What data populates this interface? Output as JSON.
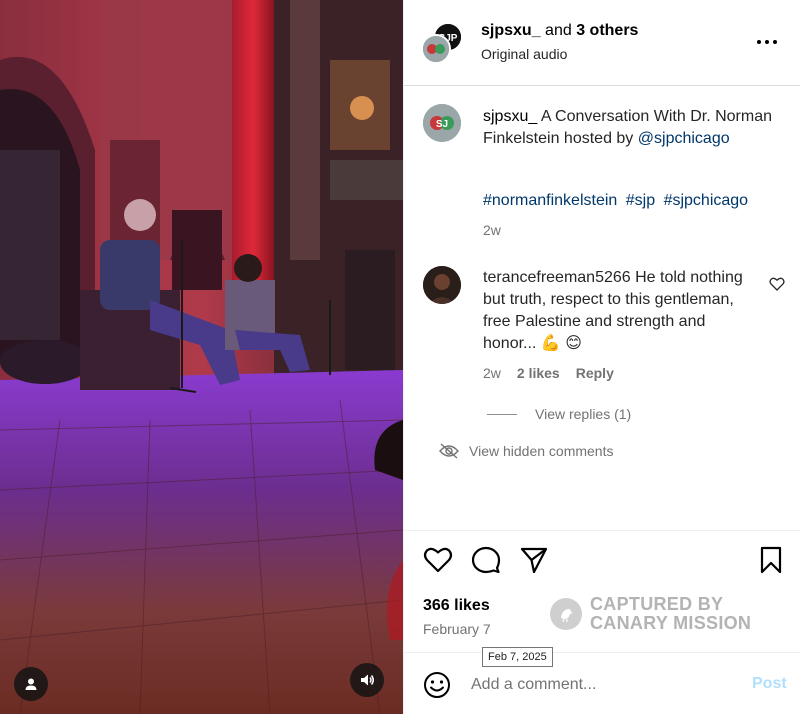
{
  "header": {
    "username": "sjpsxu_",
    "and_text": "and",
    "others": "3 others",
    "audio": "Original audio",
    "more_icon": "more-horizontal-icon"
  },
  "caption": {
    "username": "sjpsxu_",
    "text": "A Conversation With Dr. Norman Finkelstein hosted by",
    "mention": "@sjpchicago",
    "hashtags": [
      "#normanfinkelstein",
      "#sjp",
      "#sjpchicago"
    ],
    "time": "2w"
  },
  "comment": {
    "username": "terancefreeman5266",
    "text": "He told nothing but truth, respect to this gentleman, free Palestine and strength and honor...",
    "emojis": "💪 😊",
    "time": "2w",
    "likes": "2 likes",
    "reply": "Reply",
    "view_replies": "View replies (1)"
  },
  "hidden_comments": "View hidden comments",
  "actions": {
    "likes": "366 likes",
    "date": "February 7",
    "tooltip": "Feb 7, 2025"
  },
  "watermark": {
    "line1": "CAPTURED BY",
    "line2": "CANARY MISSION"
  },
  "composer": {
    "placeholder": "Add a comment...",
    "post": "Post"
  },
  "colors": {
    "link": "#00376b",
    "secondary": "#737373",
    "post_disabled": "#b2dffc"
  }
}
